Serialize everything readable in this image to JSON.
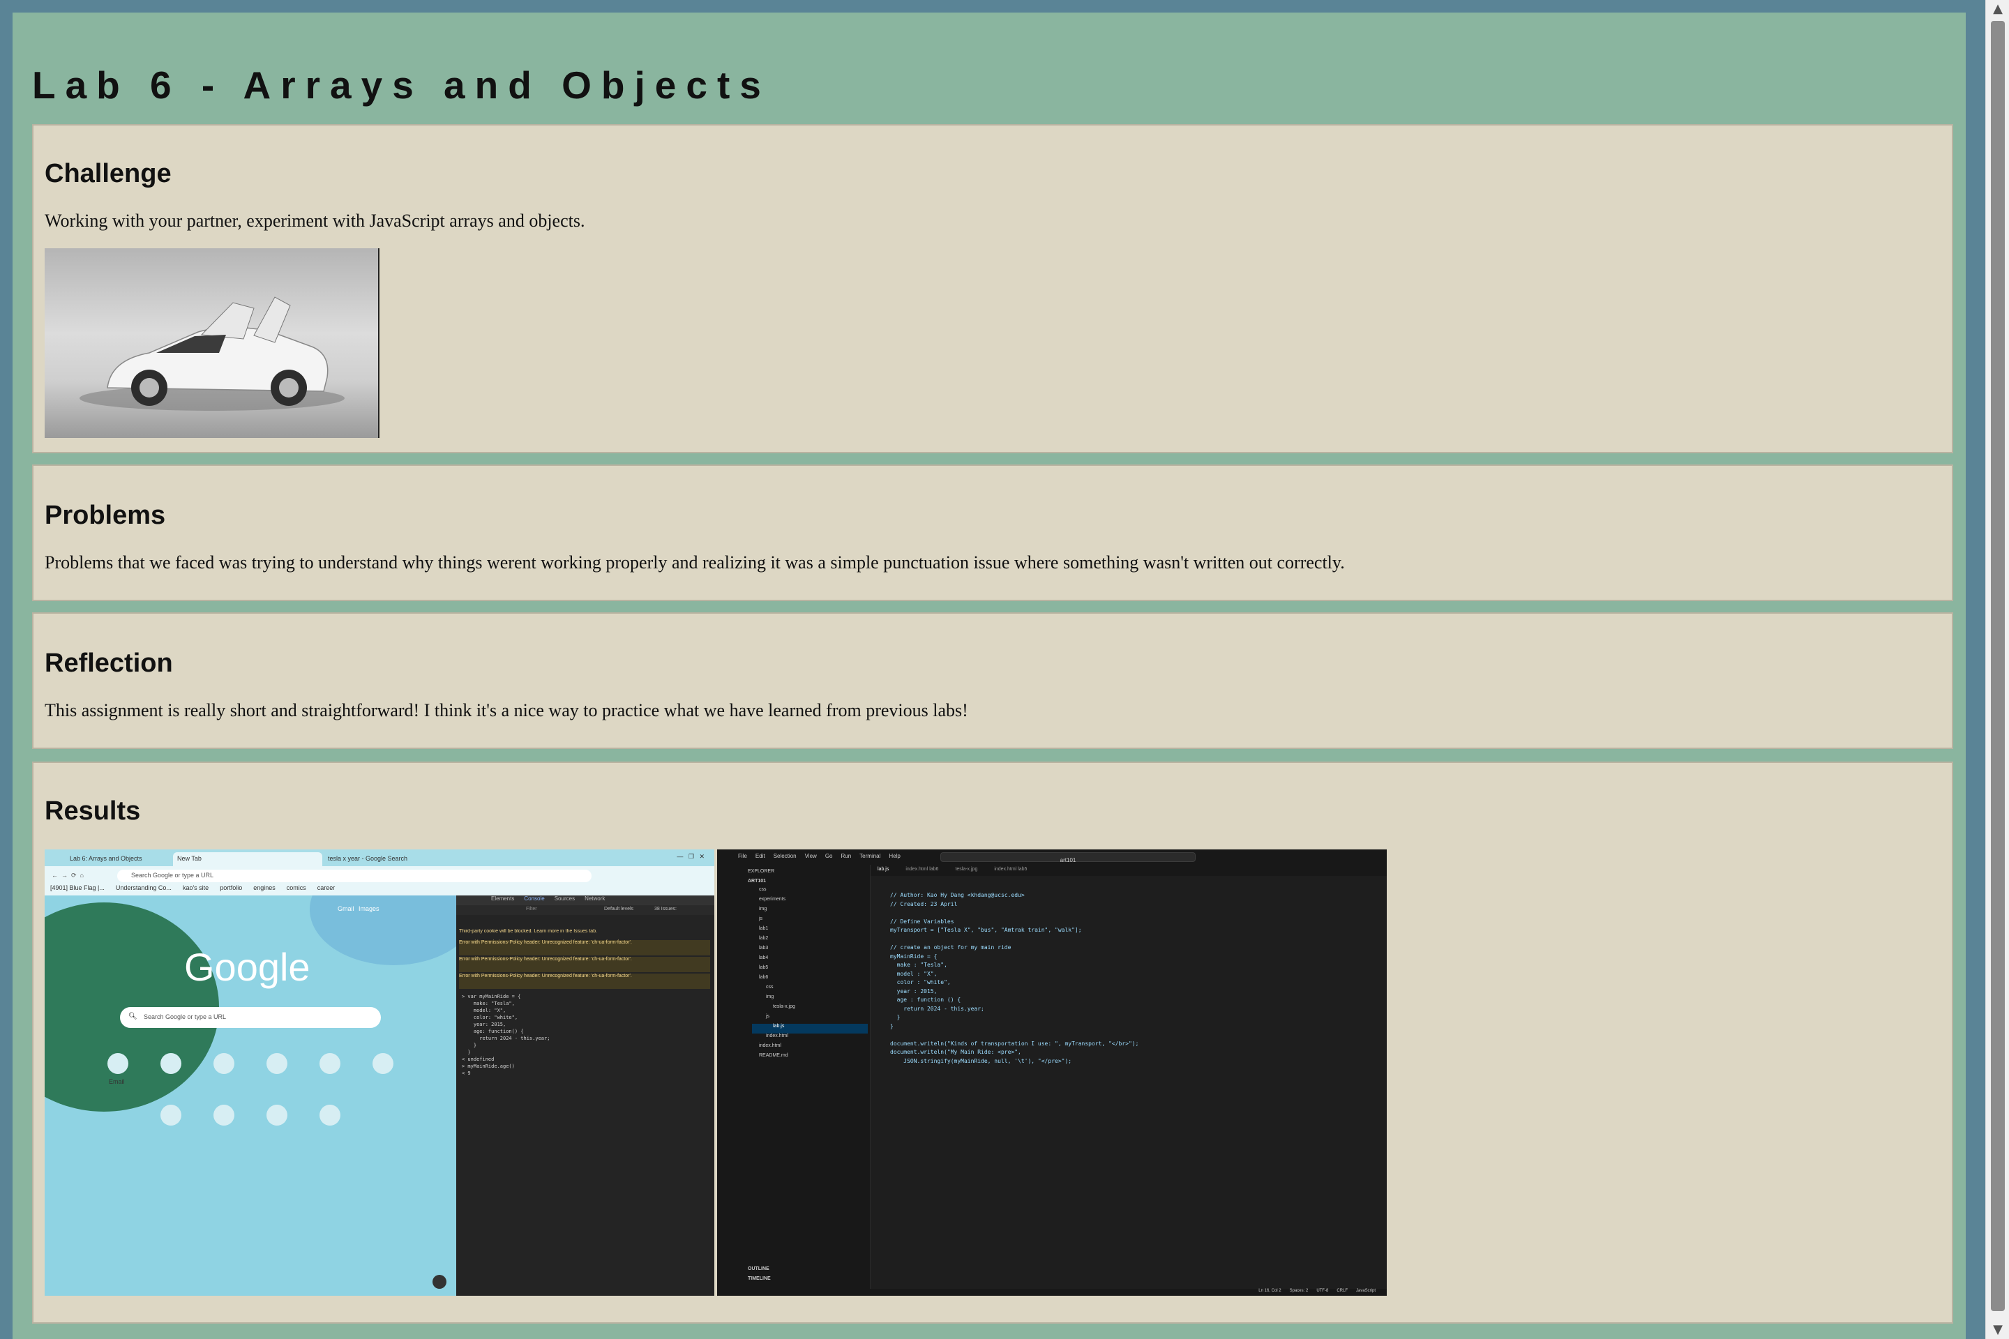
{
  "title": "Lab 6 - Arrays and Objects",
  "challenge": {
    "heading": "Challenge",
    "text": "Working with your partner, experiment with JavaScript arrays and objects."
  },
  "problems": {
    "heading": "Problems",
    "text": "Problems that we faced was trying to understand why things werent working properly and realizing it was a simple punctuation issue where something wasn't written out correctly."
  },
  "reflection": {
    "heading": "Reflection",
    "text": "This assignment is really short and straightforward! I think it's a nice way to practice what we have learned from previous labs!"
  },
  "results": {
    "heading": "Results",
    "browser": {
      "tabs": [
        "Lab 6: Arrays and Objects",
        "New Tab",
        "tesla x year - Google Search"
      ],
      "address": "Search Google or type a URL",
      "bookmarks": [
        "[4901] Blue Flag |...",
        "Understanding Co...",
        "kao's site",
        "portfolio",
        "engines",
        "comics",
        "career"
      ],
      "top_links": [
        "Gmail",
        "Images"
      ],
      "logo": "Google",
      "search_placeholder": "Search Google or type a URL",
      "shortcuts": [
        "Email",
        "",
        "",
        "",
        "",
        "",
        "",
        "",
        "",
        ""
      ],
      "devtools_tabs": [
        "Elements",
        "Console",
        "Sources",
        "Network"
      ],
      "devtools_filter": "Filter",
      "devtools_levels": "Default levels",
      "devtools_issues": "38 Issues:",
      "console_lines": [
        "Third-party cookie will be blocked. Learn more in the Issues tab.",
        "Error with Permissions-Policy header: Unrecognized feature: 'ch-ua-form-factor'.",
        "Error with Permissions-Policy header: Unrecognized feature: 'ch-ua-form-factor'.",
        "Error with Permissions-Policy header: Unrecognized feature: 'ch-ua-form-factor'."
      ],
      "console_code": "> var myMainRide = {\n    make: \"Tesla\",\n    model: \"X\",\n    color: \"white\",\n    year: 2015,\n    age: function() {\n      return 2024 - this.year;\n    }\n  }\n< undefined\n> myMainRide.age()\n< 9"
    },
    "editor": {
      "menu": [
        "File",
        "Edit",
        "Selection",
        "View",
        "Go",
        "Run",
        "Terminal",
        "Help"
      ],
      "search": "art101",
      "tabs": [
        "lab.js",
        "index.html lab6",
        "tesla-x.jpg",
        "index.html lab5"
      ],
      "explorer_title": "EXPLORER",
      "root": "ART101",
      "tree": [
        "css",
        "experiments",
        "img",
        "js",
        "lab1",
        "lab2",
        "lab3",
        "lab4",
        "lab5",
        "lab6",
        "css",
        "img",
        "tesla-x.jpg",
        "js",
        "lab.js",
        "index.html",
        "index.html",
        "README.md"
      ],
      "outline": "OUTLINE",
      "timeline": "TIMELINE",
      "code": "// Author: Kao Hy Dang <khdang@ucsc.edu>\n// Created: 23 April\n\n// Define Variables\nmyTransport = [\"Tesla X\", \"bus\", \"Amtrak train\", \"walk\"];\n\n// create an object for my main ride\nmyMainRide = {\n  make : \"Tesla\",\n  model : \"X\",\n  color : \"white\",\n  year : 2015,\n  age : function () {\n    return 2024 - this.year;\n  }\n}\n\ndocument.writeln(\"Kinds of transportation I use: \", myTransport, \"</br>\");\ndocument.writeln(\"My Main Ride: <pre>\",\n    JSON.stringify(myMainRide, null, '\\t'), \"</pre>\");",
      "status": [
        "Ln 16, Col 2",
        "Spaces: 2",
        "UTF-8",
        "CRLF",
        "JavaScript"
      ]
    }
  }
}
